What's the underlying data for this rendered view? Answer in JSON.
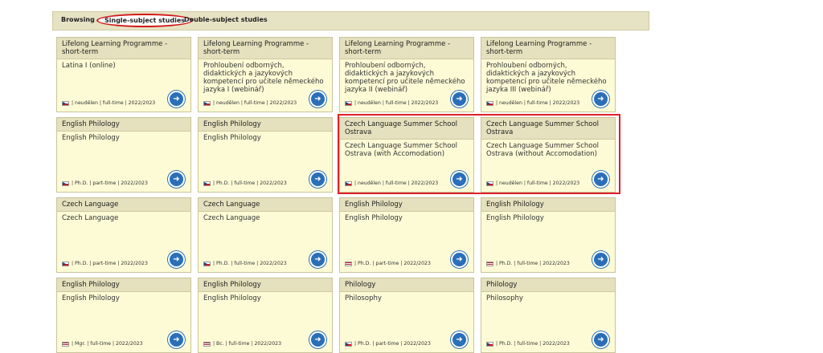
{
  "tabs": [
    {
      "label": "Browsing"
    },
    {
      "label": "Single-subject studies",
      "active": true
    },
    {
      "label": "Double-subject studies"
    }
  ],
  "rows": [
    [
      {
        "header": "Lifelong Learning Programme - short-term",
        "body": "Latina I (online)",
        "flag": "cz",
        "meta": "| neudělen | full-time | 2022/2023"
      },
      {
        "header": "Lifelong Learning Programme - short-term",
        "body": "Prohloubení odborných, didaktických a jazykových kompetencí pro učitele německého jazyka I (webinář)",
        "flag": "cz",
        "meta": "| neudělen | full-time | 2022/2023"
      },
      {
        "header": "Lifelong Learning Programme - short-term",
        "body": "Prohloubení odborných, didaktických a jazykových kompetencí pro učitele německého jazyka II (webinář)",
        "flag": "cz",
        "meta": "| neudělen | full-time | 2022/2023"
      },
      {
        "header": "Lifelong Learning Programme - short-term",
        "body": "Prohloubení odborných, didaktických a jazykových kompetencí pro učitele německého jazyka III (webinář)",
        "flag": "cz",
        "meta": "| neudělen | full-time | 2022/2023"
      }
    ],
    [
      {
        "header": "English Philology",
        "body": "English Philology",
        "flag": "cz",
        "meta": "| Ph.D. | part-time | 2022/2023"
      },
      {
        "header": "English Philology",
        "body": "English Philology",
        "flag": "cz",
        "meta": "| Ph.D. | full-time | 2022/2023"
      },
      {
        "header": "Czech Language Summer School Ostrava",
        "body": "Czech Language Summer School Ostrava (with Accomodation)",
        "flag": "cz",
        "meta": "| neudělen | full-time | 2022/2023"
      },
      {
        "header": "Czech Language Summer School Ostrava",
        "body": "Czech Language Summer School Ostrava (without Accomodation)",
        "flag": "cz",
        "meta": "| neudělen | full-time | 2022/2023"
      }
    ],
    [
      {
        "header": "Czech Language",
        "body": "Czech Language",
        "flag": "cz",
        "meta": "| Ph.D. | part-time | 2022/2023"
      },
      {
        "header": "Czech Language",
        "body": "Czech Language",
        "flag": "cz",
        "meta": "| Ph.D. | full-time | 2022/2023"
      },
      {
        "header": "English Philology",
        "body": "English Philology",
        "flag": "uk",
        "meta": "| Ph.D. | part-time | 2022/2023"
      },
      {
        "header": "English Philology",
        "body": "English Philology",
        "flag": "uk",
        "meta": "| Ph.D. | full-time | 2022/2023"
      }
    ],
    [
      {
        "header": "English Philology",
        "body": "English Philology",
        "flag": "uk",
        "meta": "| Mgr. | full-time | 2022/2023"
      },
      {
        "header": "English Philology",
        "body": "English Philology",
        "flag": "uk",
        "meta": "| Bc. | full-time | 2022/2023"
      },
      {
        "header": "Philology",
        "body": "Philosophy",
        "flag": "cz",
        "meta": "| Ph.D. | part-time | 2022/2023"
      },
      {
        "header": "Philology",
        "body": "Philosophy",
        "flag": "cz",
        "meta": "| Ph.D. | full-time | 2022/2023"
      }
    ]
  ],
  "go_icon": "arrow-right-circle-icon"
}
